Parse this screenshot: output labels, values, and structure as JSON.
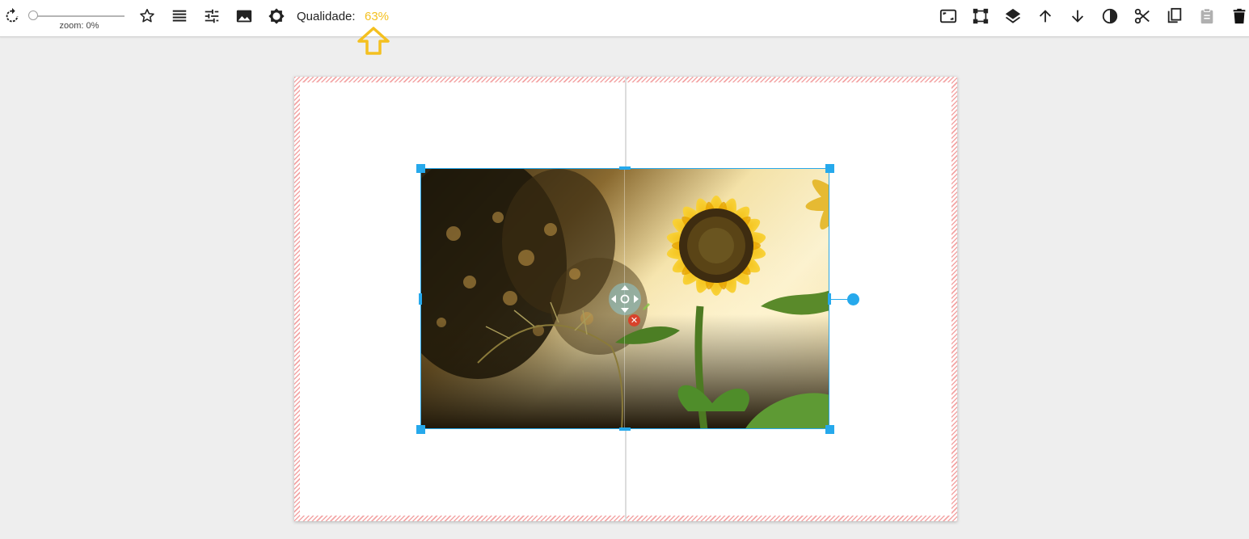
{
  "toolbar": {
    "zoom": {
      "label": "zoom: 0%",
      "value_percent": 0
    },
    "quality": {
      "label": "Qualidade:",
      "value": "63%"
    },
    "left_icons": [
      "reload-icon",
      "star-icon",
      "lines-icon",
      "tune-icon",
      "image-icon",
      "brightness-icon"
    ],
    "right_icons": [
      "aspect-ratio-icon",
      "crop-free-icon",
      "layers-icon",
      "arrow-up-icon",
      "arrow-down-icon",
      "contrast-icon",
      "scissors-icon",
      "copy-icon",
      "clipboard-icon",
      "trash-icon"
    ]
  },
  "canvas": {
    "image": "sunflower-photo",
    "selected": true
  },
  "colors": {
    "accent": "#26a9ec",
    "quality": "#f4c020",
    "page_hatch": "#f3a5a5",
    "delete": "#d8422b"
  }
}
